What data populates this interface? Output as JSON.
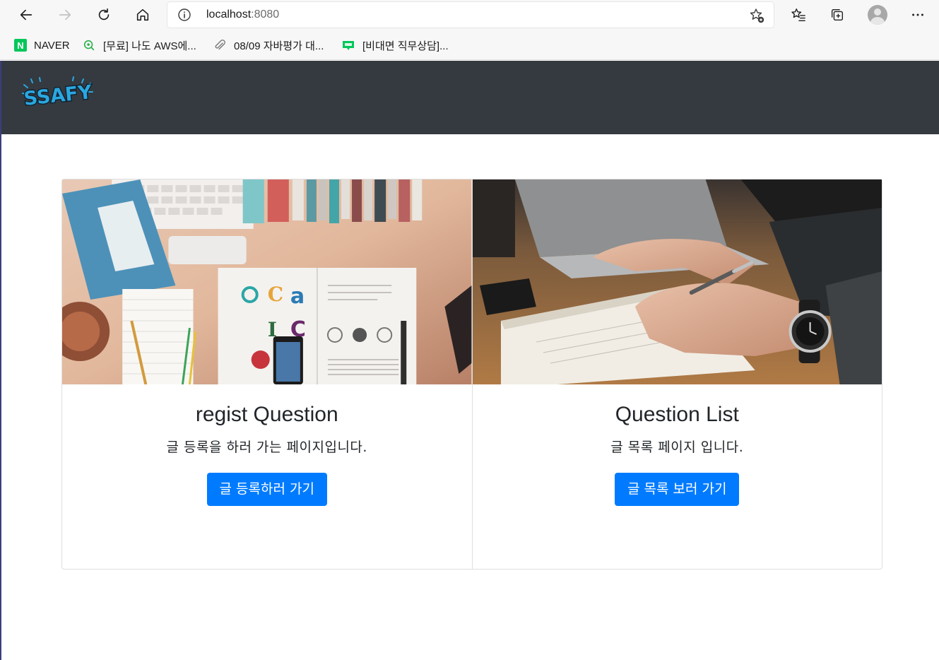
{
  "browser": {
    "url_host": "localhost",
    "url_port": ":8080",
    "bookmarks": [
      {
        "label": "NAVER",
        "icon": "naver-icon"
      },
      {
        "label": "[무료] 나도 AWS에...",
        "icon": "search-globe-icon"
      },
      {
        "label": "08/09 자바평가 대...",
        "icon": "paperclip-icon"
      },
      {
        "label": "[비대면 직무상담]...",
        "icon": "blog-icon"
      }
    ],
    "naver_letter": "N"
  },
  "navbar": {
    "logo_text": "SSAFY"
  },
  "cards": [
    {
      "title": "regist Question",
      "text": "글 등록을 하러 가는 페이지입니다.",
      "button": "글 등록하러 가기",
      "image": "desk-with-books-and-phone"
    },
    {
      "title": "Question List",
      "text": "글 목록 페이지 입니다.",
      "button": "글 목록 보러 가기",
      "image": "hand-writing-in-notebook"
    }
  ],
  "colors": {
    "navbar": "#343a40",
    "primary": "#007bff",
    "browser_bg": "#f7f7f7"
  }
}
